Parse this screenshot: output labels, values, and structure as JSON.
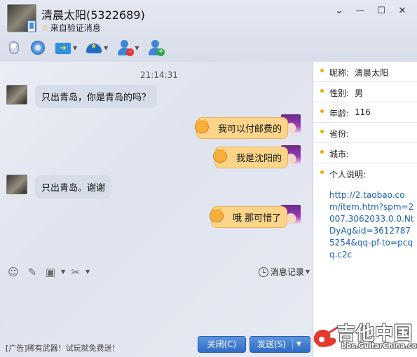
{
  "header": {
    "contact_name": "清晨太阳(5322689)",
    "subtitle": "来自验证消息",
    "window_controls": {
      "menu": "⌄",
      "minimize": "—",
      "maximize": "☐",
      "close": "✕"
    },
    "toolbar": {
      "voice": "microphone-icon",
      "video": "webcam-icon",
      "file": "send-file-icon",
      "apps": "app-center-icon",
      "remove": "remove-user-icon",
      "add": "add-user-icon"
    }
  },
  "chat": {
    "timestamp": "21:14:31",
    "messages": [
      {
        "side": "left",
        "text": "只出青岛，你是青岛的吗？"
      },
      {
        "side": "right",
        "text": "我可以付邮费的"
      },
      {
        "side": "right",
        "text": "我是沈阳的"
      },
      {
        "side": "left",
        "text": "只出青岛。谢谢"
      },
      {
        "side": "right",
        "text": "哦 那可惜了"
      }
    ]
  },
  "input_bar": {
    "emoji": "☺",
    "font": "✎",
    "image": "▣",
    "screenshot": "✂",
    "history_label": "消息记录"
  },
  "footer": {
    "ad_text": "[广告]稀有武器！试玩就免费送！",
    "close_label": "关闭(C)",
    "send_label": "发送(S)"
  },
  "profile": {
    "nickname_label": "昵称:",
    "nickname_value": "清晨太阳",
    "gender_label": "性别:",
    "gender_value": "男",
    "age_label": "年龄:",
    "age_value": "116",
    "province_label": "省份:",
    "city_label": "城市:",
    "intro_label": "个人说明:",
    "intro_text": "http://2.taobao.com/item.htm?spm=2007.3062033.0.0.NtDyAg&id=36127875254&qq-pf-to=pcqq.c2c"
  },
  "watermark": {
    "title": "吉他中国",
    "url": "bbs.GuitarChina.com"
  },
  "colors": {
    "accent_blue": "#2f6cc6",
    "bubble_self": "#fcd58a",
    "bubble_other": "#d6dde8",
    "dot_orange": "#f0a800"
  }
}
